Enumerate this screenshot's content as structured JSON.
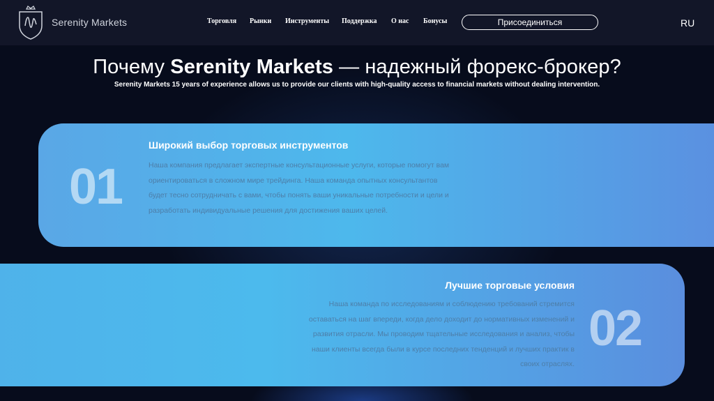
{
  "header": {
    "brand": "Serenity Markets",
    "nav": [
      "Торговля",
      "Рынки",
      "Инструменты",
      "Поддержка",
      "О нас",
      "Бонусы"
    ],
    "join_label": "Присоединиться",
    "lang": "RU"
  },
  "hero": {
    "title_prefix": "Почему ",
    "title_brand": "Serenity Markets",
    "title_suffix": " — надежный форекс-брокер?",
    "subtitle": "Serenity Markets 15 years of experience allows us to provide our clients with high-quality access to financial markets without dealing intervention."
  },
  "cards": [
    {
      "number": "01",
      "title": "Широкий выбор торговых инструментов",
      "text": "Наша компания предлагает экспертные консультационные услуги, которые помогут вам ориентироваться в сложном мире трейдинга. Наша команда опытных консультантов будет тесно сотрудничать с вами, чтобы понять ваши уникальные потребности и цели и разработать индивидуальные решения для достижения ваших целей."
    },
    {
      "number": "02",
      "title": "Лучшие торговые условия",
      "text": "Наша команда по исследованиям и соблюдению требований стремится оставаться на шаг впереди, когда дело доходит до нормативных изменений и развития отрасли. Мы проводим тщательные исследования и анализ, чтобы наши клиенты всегда были в курсе последних тенденций и лучших практик в своих отраслях."
    }
  ],
  "colors": {
    "background": "#070c1c",
    "header": "#121628",
    "card_start": "#5aa7e6",
    "card_end": "#5b8fe0",
    "card_text": "#4d7ea8"
  },
  "icons": {
    "logo": "crown-shield-logo-icon"
  }
}
